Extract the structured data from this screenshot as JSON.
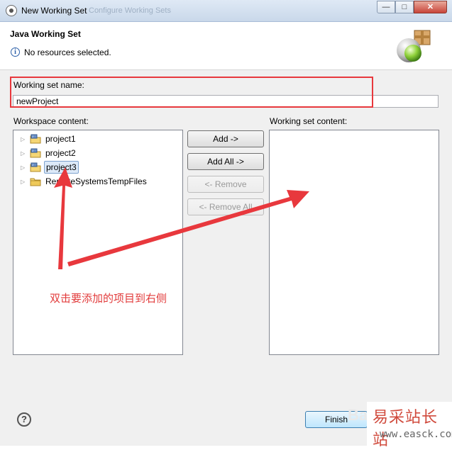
{
  "window": {
    "title": "New Working Set",
    "ghost_title": "Configure Working Sets",
    "minimize_glyph": "—",
    "maximize_glyph": "□",
    "close_glyph": "✕"
  },
  "header": {
    "title": "Java Working Set",
    "info_icon_glyph": "i",
    "message": "No resources selected."
  },
  "form": {
    "name_label": "Working set name:",
    "name_value": "newProject",
    "workspace_label": "Workspace content:",
    "working_set_label": "Working set content:"
  },
  "workspace_tree": [
    {
      "label": "project1",
      "expander": "▷",
      "icon": "java-project-icon"
    },
    {
      "label": "project2",
      "expander": "▷",
      "icon": "java-project-icon"
    },
    {
      "label": "project3",
      "expander": "▷",
      "icon": "java-project-icon",
      "selected": true
    },
    {
      "label": "RemoteSystemsTempFiles",
      "expander": "▷",
      "icon": "folder-icon"
    }
  ],
  "buttons": {
    "add": "Add ->",
    "add_all": "Add All ->",
    "remove": "<- Remove",
    "remove_all": "<- Remove All",
    "finish": "Finish",
    "help_glyph": "?"
  },
  "annotation": {
    "text": "双击要添加的项目到右侧",
    "color": "#e23b3b"
  },
  "watermark": {
    "ghost": "Ba",
    "brand": "易采站长站",
    "url": "www.easck.com"
  }
}
